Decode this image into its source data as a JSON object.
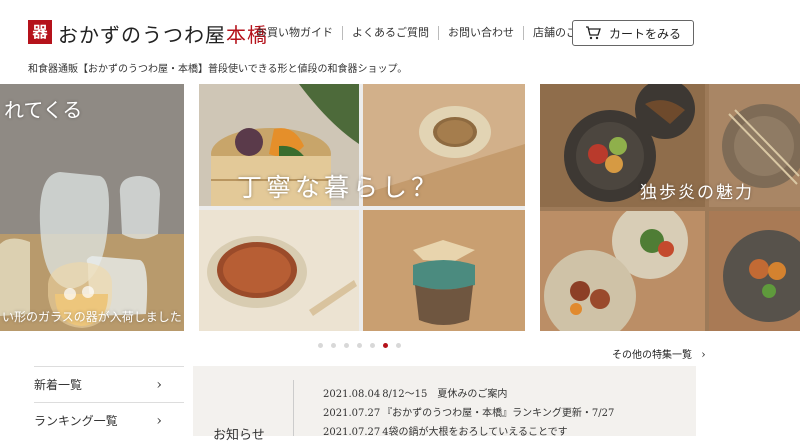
{
  "header": {
    "logo_mark": "器",
    "logo_text_main": "おかずのうつわ屋",
    "logo_text_accent": "本橋",
    "nav": [
      "お買い物ガイド",
      "よくあるご質問",
      "お問い合わせ",
      "店舗のご案内"
    ],
    "cart_label": "カートをみる"
  },
  "tagline": "和食器通販【おかずのうつわ屋・本橋】普段使いできる形と値段の和食器ショップ。",
  "slider": {
    "slide1_title": "れてくる",
    "slide1_caption": "い形のガラスの器が入荷しました",
    "slide2_title": "丁寧な暮らし？",
    "slide3_title": "独歩炎の魅力",
    "dot_count": 7,
    "active_dot": 5,
    "more_link": "その他の特集一覧"
  },
  "side_menu": [
    {
      "label": "新着一覧"
    },
    {
      "label": "ランキング一覧"
    }
  ],
  "news": {
    "title": "お知らせ",
    "items": [
      {
        "date": "2021.08.04",
        "text": "8/12～15　夏休みのご案内"
      },
      {
        "date": "2021.07.27",
        "text": "『おかずのうつわ屋・本橋』ランキング更新・7/27"
      },
      {
        "date": "2021.07.27",
        "text": "4袋の鍋が大根をおろしていえることです"
      }
    ]
  },
  "colors": {
    "accent": "#b5121b",
    "news_bg": "#f3f1ee"
  }
}
